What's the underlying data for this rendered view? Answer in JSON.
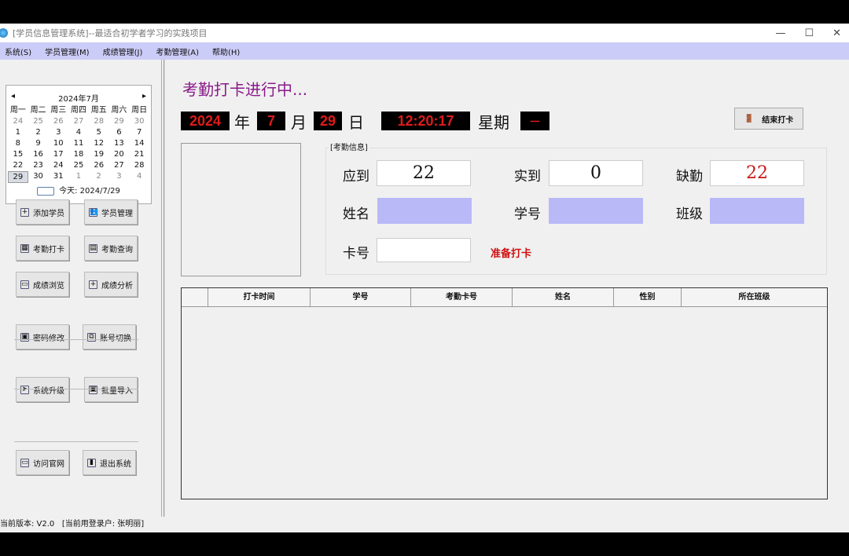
{
  "window": {
    "title": "[学员信息管理系统]--最适合初学者学习的实践项目",
    "minimize": "—",
    "maximize": "☐",
    "close": "✕"
  },
  "menu": [
    "系统(S)",
    "学员管理(M)",
    "成绩管理(J)",
    "考勤管理(A)",
    "帮助(H)"
  ],
  "calendar": {
    "month_label": "2024年7月",
    "prev": "◂",
    "next": "▸",
    "weekdays": [
      "周一",
      "周二",
      "周三",
      "周四",
      "周五",
      "周六",
      "周日"
    ],
    "days": [
      [
        "24",
        1
      ],
      [
        "25",
        1
      ],
      [
        "26",
        1
      ],
      [
        "27",
        1
      ],
      [
        "28",
        1
      ],
      [
        "29",
        1
      ],
      [
        "30",
        1
      ],
      [
        "1",
        0
      ],
      [
        "2",
        0
      ],
      [
        "3",
        0
      ],
      [
        "4",
        0
      ],
      [
        "5",
        0
      ],
      [
        "6",
        0
      ],
      [
        "7",
        0
      ],
      [
        "8",
        0
      ],
      [
        "9",
        0
      ],
      [
        "10",
        0
      ],
      [
        "11",
        0
      ],
      [
        "12",
        0
      ],
      [
        "13",
        0
      ],
      [
        "14",
        0
      ],
      [
        "15",
        0
      ],
      [
        "16",
        0
      ],
      [
        "17",
        0
      ],
      [
        "18",
        0
      ],
      [
        "19",
        0
      ],
      [
        "20",
        0
      ],
      [
        "21",
        0
      ],
      [
        "22",
        0
      ],
      [
        "23",
        0
      ],
      [
        "24",
        0
      ],
      [
        "25",
        0
      ],
      [
        "26",
        0
      ],
      [
        "27",
        0
      ],
      [
        "28",
        0
      ],
      [
        "29",
        2
      ],
      [
        "30",
        0
      ],
      [
        "31",
        0
      ],
      [
        "1",
        1
      ],
      [
        "2",
        1
      ],
      [
        "3",
        1
      ],
      [
        "4",
        1
      ]
    ],
    "today": "今天: 2024/7/29"
  },
  "sidebar": {
    "buttons": [
      {
        "label": "添加学员",
        "icon": "+"
      },
      {
        "label": "学员管理",
        "icon": "👥"
      },
      {
        "label": "考勤打卡",
        "icon": "▦"
      },
      {
        "label": "考勤查询",
        "icon": "▤"
      },
      {
        "label": "成绩浏览",
        "icon": "▭"
      },
      {
        "label": "成绩分析",
        "icon": "+"
      },
      {
        "label": "密码修改",
        "icon": "▣"
      },
      {
        "label": "账号切换",
        "icon": "⧉"
      },
      {
        "label": "系统升级",
        "icon": "➤"
      },
      {
        "label": "批量导入",
        "icon": "▣"
      },
      {
        "label": "访问官网",
        "icon": "▭"
      },
      {
        "label": "退出系统",
        "icon": "▮"
      }
    ]
  },
  "main": {
    "heading": "考勤打卡进行中...",
    "year": "2024",
    "year_unit": "年",
    "month": "7",
    "month_unit": "月",
    "day": "29",
    "day_unit": "日",
    "time": "12:20:17",
    "weekday_label": "星期",
    "weekday": "一",
    "end_button": "结束打卡",
    "group_label": "[考勤信息]",
    "expected_label": "应到",
    "expected": "22",
    "actual_label": "实到",
    "actual": "0",
    "absent_label": "缺勤",
    "absent": "22",
    "name_label": "姓名",
    "name": "",
    "id_label": "学号",
    "id": "",
    "class_label": "班级",
    "class": "",
    "card_label": "卡号",
    "card": "",
    "ready": "准备打卡"
  },
  "table": {
    "columns": [
      "",
      "打卡时间",
      "学号",
      "考勤卡号",
      "姓名",
      "性别",
      "所在班级"
    ]
  },
  "status": {
    "version": "当前版本: V2.0",
    "user": "[当前用登录户:   张明丽]"
  }
}
